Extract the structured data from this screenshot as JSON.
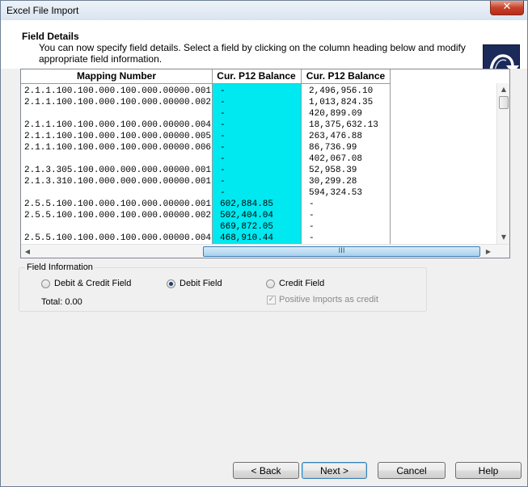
{
  "window": {
    "title": "Excel File Import"
  },
  "header": {
    "title": "Field Details",
    "description": "You can now specify field details. Select a field by clicking on the column heading below and modify appropriate field information."
  },
  "grid": {
    "columns": [
      "Mapping Number",
      "Cur. P12 Balance",
      "Cur. P12 Balance"
    ],
    "rows": [
      [
        "2.1.1.100.100.000.100.000.00000.001",
        "-",
        "2,496,956.10"
      ],
      [
        "2.1.1.100.100.000.100.000.00000.002",
        "-",
        "1,013,824.35"
      ],
      [
        "",
        "-",
        "420,899.09"
      ],
      [
        "2.1.1.100.100.000.100.000.00000.004",
        "-",
        "18,375,632.13"
      ],
      [
        "2.1.1.100.100.000.100.000.00000.005",
        "-",
        "263,476.88"
      ],
      [
        "2.1.1.100.100.000.100.000.00000.006",
        "-",
        "86,736.99"
      ],
      [
        "",
        "-",
        "402,067.08"
      ],
      [
        "2.1.3.305.100.000.000.000.00000.001",
        "-",
        "52,958.39"
      ],
      [
        "2.1.3.310.100.000.000.000.00000.001",
        "-",
        "30,299.28"
      ],
      [
        "",
        "-",
        "594,324.53"
      ],
      [
        "2.5.5.100.100.000.100.000.00000.001",
        "602,884.85",
        "-"
      ],
      [
        "2.5.5.100.100.000.100.000.00000.002",
        "502,404.04",
        "-"
      ],
      [
        "",
        "669,872.05",
        "-"
      ],
      [
        "2.5.5.100.100.000.100.000.00000.004",
        "468,910.44",
        "-"
      ]
    ],
    "hscroll_thumb_label": "III"
  },
  "field_info": {
    "legend": "Field Information",
    "options": [
      "Debit & Credit Field",
      "Debit Field",
      "Credit Field"
    ],
    "selected": "Debit Field",
    "total": "Total: 0.00",
    "positive_imports_label": "Positive Imports as credit",
    "positive_imports_checked": true
  },
  "buttons": {
    "back": "< Back",
    "next": "Next >",
    "cancel": "Cancel",
    "help": "Help"
  },
  "colors": {
    "selected_column": "#00e8f0",
    "close_button": "#c7422b",
    "logo_background": "#1c2a5a"
  },
  "icons": {
    "close": "close-icon",
    "logo": "wizard-arrow-icon"
  }
}
